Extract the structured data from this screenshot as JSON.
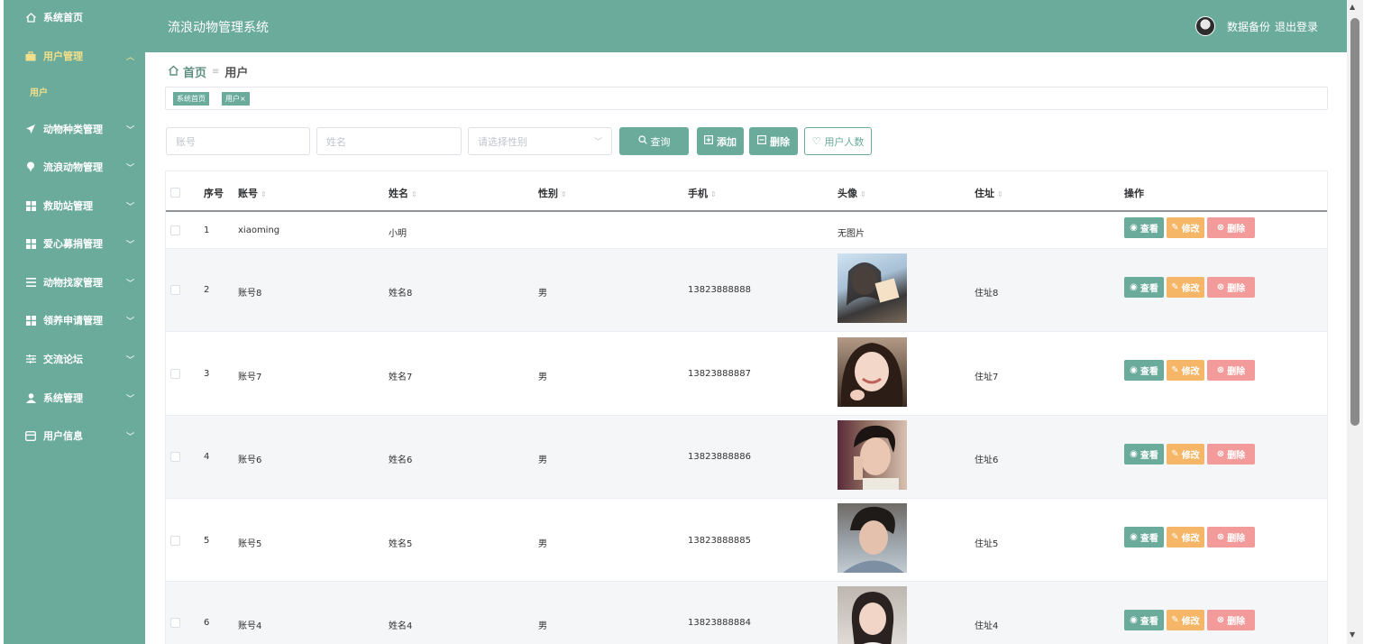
{
  "app": {
    "title": "流浪动物管理系统",
    "backup_label": "数据备份",
    "logout_label": "退出登录"
  },
  "colors": {
    "primary": "#6aab9c",
    "warning": "#f5b667",
    "danger": "#f39a9a",
    "active_text": "#f3e08a"
  },
  "sidebar": {
    "items": [
      {
        "label": "系统首页",
        "icon": "home-icon",
        "expandable": false
      },
      {
        "label": "用户管理",
        "icon": "briefcase-icon",
        "expandable": true,
        "expanded": true
      },
      {
        "label": "动物种类管理",
        "icon": "send-icon",
        "expandable": true
      },
      {
        "label": "流浪动物管理",
        "icon": "pin-icon",
        "expandable": true
      },
      {
        "label": "救助站管理",
        "icon": "grid-icon",
        "expandable": true
      },
      {
        "label": "爱心募捐管理",
        "icon": "grid-icon",
        "expandable": true
      },
      {
        "label": "动物找家管理",
        "icon": "menu-icon",
        "expandable": true
      },
      {
        "label": "领养申请管理",
        "icon": "grid-icon",
        "expandable": true
      },
      {
        "label": "交流论坛",
        "icon": "sliders-icon",
        "expandable": true
      },
      {
        "label": "系统管理",
        "icon": "user-icon",
        "expandable": true
      },
      {
        "label": "用户信息",
        "icon": "card-icon",
        "expandable": true
      }
    ],
    "subitem": "用户"
  },
  "breadcrumb": {
    "home": "首页",
    "current": "用户"
  },
  "tags": [
    {
      "label": "系统首页"
    },
    {
      "label": "用户×"
    }
  ],
  "search": {
    "account_placeholder": "账号",
    "name_placeholder": "姓名",
    "gender_placeholder": "请选择性别",
    "query_label": "查询",
    "add_label": "添加",
    "delete_label": "删除",
    "count_label": "用户人数"
  },
  "table": {
    "headers": {
      "index": "序号",
      "account": "账号",
      "name": "姓名",
      "gender": "性别",
      "phone": "手机",
      "avatar": "头像",
      "address": "住址",
      "actions": "操作"
    },
    "no_image": "无图片",
    "actions": {
      "view": "查看",
      "edit": "修改",
      "delete": "删除"
    },
    "rows": [
      {
        "index": "1",
        "account": "xiaoming",
        "name": "小明",
        "gender": "",
        "phone": "",
        "address": "",
        "has_photo": false
      },
      {
        "index": "2",
        "account": "账号8",
        "name": "姓名8",
        "gender": "男",
        "phone": "13823888888",
        "address": "住址8",
        "has_photo": true
      },
      {
        "index": "3",
        "account": "账号7",
        "name": "姓名7",
        "gender": "男",
        "phone": "13823888887",
        "address": "住址7",
        "has_photo": true
      },
      {
        "index": "4",
        "account": "账号6",
        "name": "姓名6",
        "gender": "男",
        "phone": "13823888886",
        "address": "住址6",
        "has_photo": true
      },
      {
        "index": "5",
        "account": "账号5",
        "name": "姓名5",
        "gender": "男",
        "phone": "13823888885",
        "address": "住址5",
        "has_photo": true
      },
      {
        "index": "6",
        "account": "账号4",
        "name": "姓名4",
        "gender": "男",
        "phone": "13823888884",
        "address": "住址4",
        "has_photo": true
      }
    ]
  }
}
